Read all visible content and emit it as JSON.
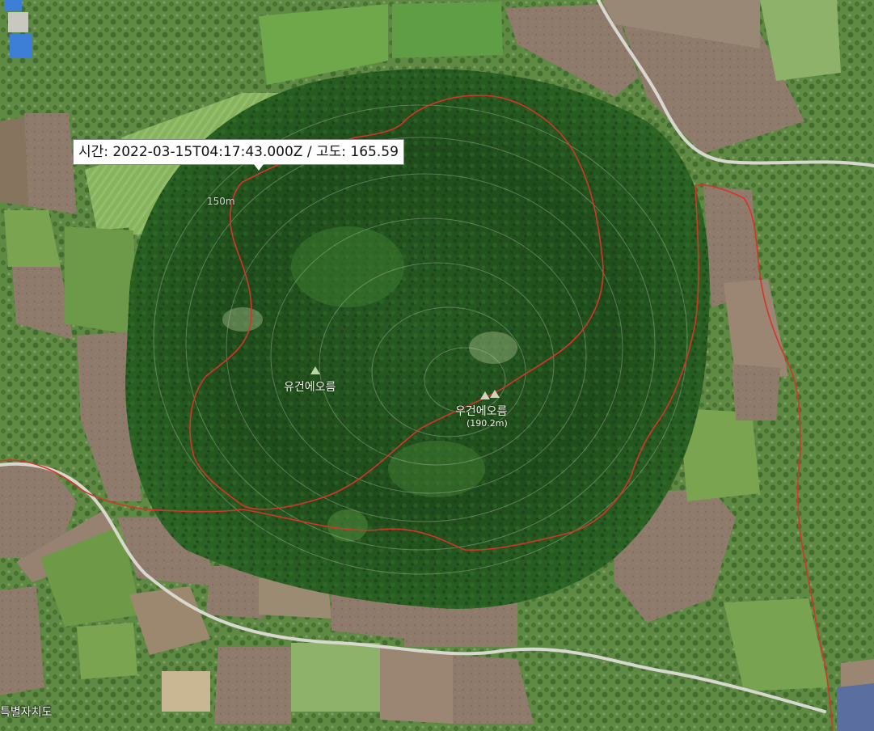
{
  "tooltip": {
    "time_label": "시간:",
    "time_value": "2022-03-15T04:17:43.000Z",
    "separator": "/",
    "elevation_label": "고도:",
    "elevation_value": "165.59"
  },
  "contour_label": "150m",
  "peaks": [
    {
      "name": "유건에오름"
    },
    {
      "name": "우건에오름",
      "elevation": "(190.2m)"
    }
  ],
  "region_label": "특별자치도",
  "colors": {
    "track": "#d9332a",
    "forest_dark": "#1f4a1c",
    "forest_mid": "#2f6a28",
    "field_green": "#7fae57",
    "field_brown": "#8c7868",
    "road": "#d8d8d0"
  }
}
